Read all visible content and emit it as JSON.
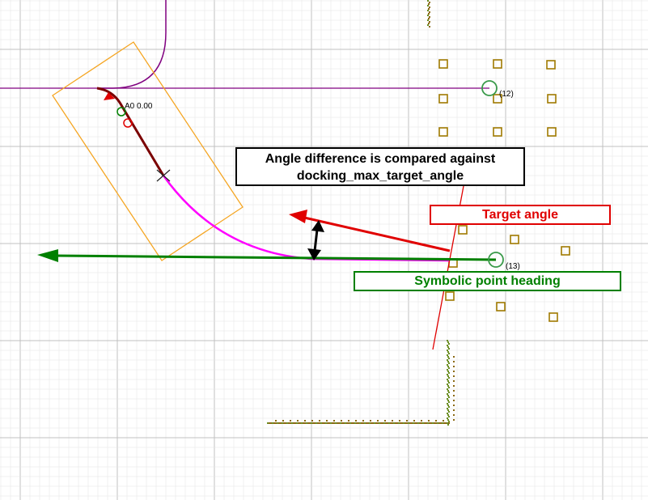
{
  "callouts": {
    "angle_difference_line1": "Angle difference is compared against",
    "angle_difference_line2": "docking_max_target_angle",
    "target_angle": "Target angle",
    "symbolic_point_heading": "Symbolic point heading"
  },
  "map_labels": {
    "pose_label": "A0 0.00",
    "point_12": "(12)",
    "point_13": "(13)"
  },
  "colors": {
    "grid_major": "#c0c0c0",
    "grid_minor": "#e6e6e6",
    "robot_footprint": "#f5a623",
    "path_traveled": "#7b0000",
    "planned_curve": "#ff00ff",
    "guide_line": "#800080",
    "target_angle_arrow": "#e00000",
    "heading_arrow": "#008000",
    "obstacle": "#a07a00"
  }
}
